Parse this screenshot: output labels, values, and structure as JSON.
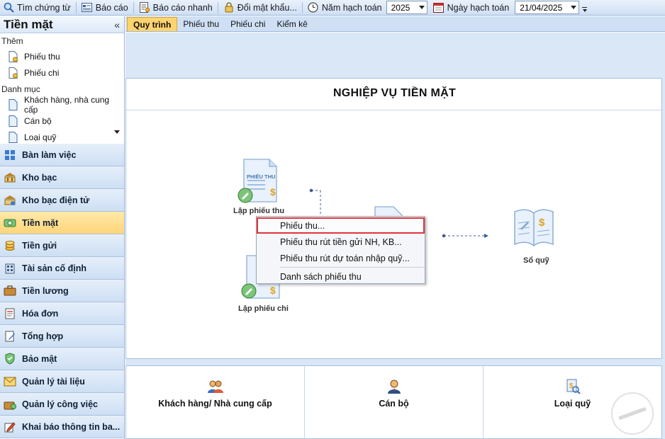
{
  "toolbar": {
    "search_voucher": "Tìm chứng từ",
    "report": "Báo cáo",
    "quick_report": "Báo cáo nhanh",
    "change_password": "Đổi mật khẩu...",
    "fiscal_year_label": "Năm hạch toán",
    "fiscal_year_value": "2025",
    "posting_date_label": "Ngày hạch toán",
    "posting_date_value": "21/04/2025"
  },
  "left_panel": {
    "title": "Tiền mặt",
    "collapse_glyph": "«",
    "add_group": "Thêm",
    "add_items": [
      "Phiếu thu",
      "Phiếu chi"
    ],
    "catalog_group": "Danh mục",
    "catalog_items": [
      "Khách hàng, nhà cung cấp",
      "Cán bộ",
      "Loại quỹ"
    ]
  },
  "nav": {
    "items": [
      "Bàn làm việc",
      "Kho bạc",
      "Kho bạc điện tử",
      "Tiền mặt",
      "Tiền gửi",
      "Tài sản cố định",
      "Tiền lương",
      "Hóa đơn",
      "Tổng hợp",
      "Bảo mật",
      "Quản lý tài liệu",
      "Quản lý công việc",
      "Khai báo thông tin ba..."
    ],
    "active": "Tiền mặt"
  },
  "tabs": [
    "Quy trình",
    "Phiếu thu",
    "Phiếu chi",
    "Kiểm kê"
  ],
  "active_tab": "Quy trình",
  "process": {
    "title": "NGHIỆP VỤ TIỀN MẶT",
    "receipt_doc_text": "PHIẾU THU",
    "receipt_label": "Lập phiếu thu",
    "payment_label": "Lập phiếu chi",
    "ledger_label": "Sổ quỹ"
  },
  "context_menu": {
    "items": [
      "Phiếu thu...",
      "Phiếu thu rút tiền gửi NH, KB...",
      "Phiếu thu rút dự toán nhập quỹ...",
      "Danh sách phiếu thu"
    ],
    "highlighted": "Phiếu thu..."
  },
  "shortcuts": [
    "Khách hàng/ Nhà cung cấp",
    "Cán bộ",
    "Loại quỹ"
  ],
  "colors": {
    "accent": "#ffd36e",
    "nav_bg": "#cddff4",
    "highlight_border": "#e0353a",
    "main_bg": "#d9e7f7"
  }
}
